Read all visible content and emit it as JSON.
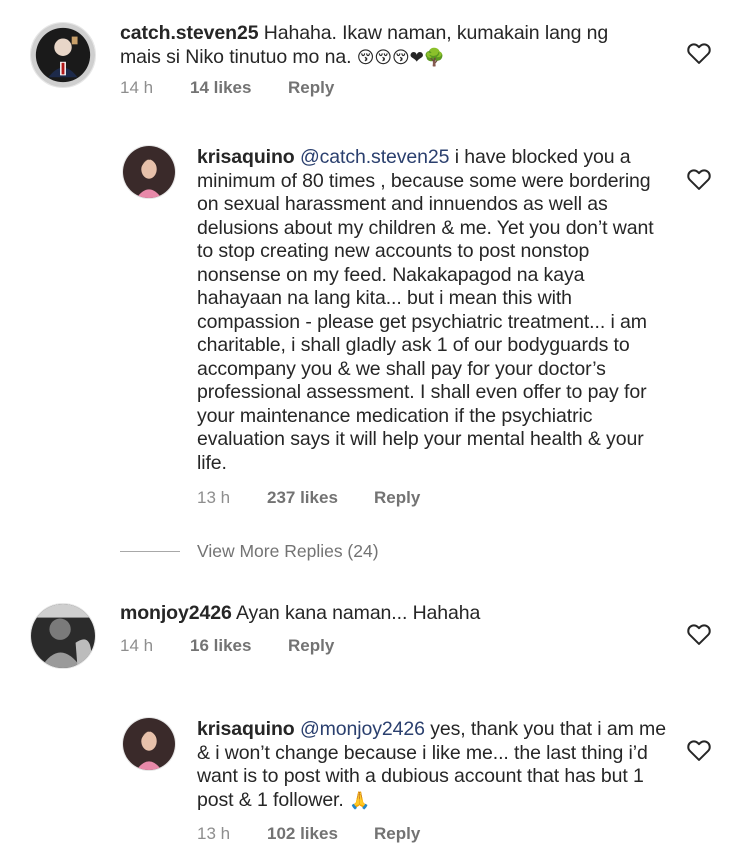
{
  "comments": [
    {
      "username": "catch.steven25",
      "text": "Hahaha. Ikaw naman, kumakain lang ng mais si Niko tinutuo mo na.",
      "emojis": "😚😚😚❤🌳",
      "time": "14 h",
      "likes": "14 likes",
      "reply": "Reply"
    },
    {
      "username": "krisaquino",
      "mention": "@catch.steven25",
      "text": "i have blocked you a minimum of 80 times , because some were bordering on sexual harassment and innuendos as well as delusions about my children & me. Yet you don’t want to stop creating new accounts to post nonstop nonsense on my feed. Nakakapagod na kaya hahayaan na lang kita... but i mean this with compassion - please get psychiatric treatment... i am charitable, i shall gladly ask 1 of our bodyguards to accompany you & we shall pay for your doctor’s professional assessment. I shall even offer to pay for your maintenance medication if the psychiatric evaluation says it will help your mental health & your life.",
      "time": "13 h",
      "likes": "237 likes",
      "reply": "Reply"
    },
    {
      "username": "monjoy2426",
      "text": "Ayan kana naman... Hahaha",
      "time": "14 h",
      "likes": "16 likes",
      "reply": "Reply"
    },
    {
      "username": "krisaquino",
      "mention": "@monjoy2426",
      "text": "yes, thank you that i am me & i won’t change because i like me... the last thing i’d want is to post with a dubious account that has but 1 post & 1 follower. ",
      "emojis": "🙏",
      "time": "13 h",
      "likes": "102 likes",
      "reply": "Reply"
    }
  ],
  "view_more": "View More Replies (24)",
  "icons": {
    "like": "heart-outline-icon"
  }
}
